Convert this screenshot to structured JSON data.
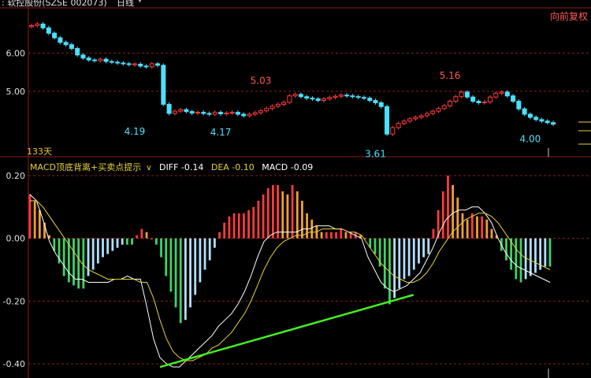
{
  "header": {
    "title": ": 软控股份(SZSE 002073)",
    "period": "日线",
    "adjust_button": "向前复权",
    "days_label": "133天"
  },
  "indicator_bar": {
    "name": "MACD顶底背离+买卖点提示",
    "diff": "DIFF -0.14",
    "dea": "DEA -0.10",
    "macd": "MACD -0.09"
  },
  "colors": {
    "background": "#000000",
    "up": "#ff3b3b",
    "up_light": "#f0a030",
    "down": "#4be0ff",
    "down_green": "#3fd36a",
    "down_light": "#b0e0ff",
    "diff_line": "#ffffff",
    "dea_line": "#e6d23a",
    "divergence_line": "#44ee22",
    "grid": "#8a1d1d",
    "axis_text": "#e0e0e0"
  },
  "chart_data": [
    {
      "type": "candlestick",
      "title": "",
      "y_ticks": [
        "6.00",
        "5.00"
      ],
      "ylim": [
        3.35,
        7.1
      ],
      "annotations": [
        {
          "label": "4.19",
          "index": 18,
          "value": 4.19,
          "kind": "low"
        },
        {
          "label": "4.17",
          "index": 33,
          "value": 4.17,
          "kind": "low"
        },
        {
          "label": "5.03",
          "index": 40,
          "value": 5.03,
          "kind": "high"
        },
        {
          "label": "3.61",
          "index": 60,
          "value": 3.61,
          "kind": "low"
        },
        {
          "label": "5.16",
          "index": 73,
          "value": 5.16,
          "kind": "high"
        },
        {
          "label": "4.00",
          "index": 87,
          "value": 4.0,
          "kind": "low"
        }
      ],
      "closes": [
        6.72,
        6.76,
        6.66,
        6.52,
        6.4,
        6.28,
        6.22,
        6.12,
        5.95,
        5.87,
        5.82,
        5.8,
        5.84,
        5.78,
        5.76,
        5.74,
        5.72,
        5.7,
        5.71,
        5.66,
        5.64,
        5.72,
        5.68,
        4.66,
        4.42,
        4.48,
        4.52,
        4.47,
        4.43,
        4.45,
        4.42,
        4.4,
        4.45,
        4.41,
        4.43,
        4.45,
        4.4,
        4.36,
        4.4,
        4.44,
        4.49,
        4.55,
        4.61,
        4.66,
        4.71,
        4.88,
        4.92,
        4.86,
        4.82,
        4.8,
        4.76,
        4.8,
        4.84,
        4.87,
        4.9,
        4.88,
        4.86,
        4.84,
        4.82,
        4.76,
        4.7,
        4.6,
        3.88,
        4.05,
        4.16,
        4.22,
        4.28,
        4.32,
        4.36,
        4.42,
        4.48,
        4.55,
        4.62,
        4.74,
        4.86,
        4.98,
        4.85,
        4.74,
        4.7,
        4.72,
        4.85,
        4.95,
        4.98,
        4.88,
        4.74,
        4.54,
        4.4,
        4.32,
        4.26,
        4.22,
        4.18,
        4.14
      ]
    },
    {
      "type": "bar+line",
      "title": "",
      "y_ticks": [
        "0.20",
        "0.00",
        "-0.20",
        "-0.40"
      ],
      "ylim": [
        -0.42,
        0.2
      ],
      "series": [
        {
          "name": "DIFF",
          "values": [
            0.14,
            0.12,
            0.06,
            -0.01,
            -0.05,
            -0.08,
            -0.11,
            -0.13,
            -0.13,
            -0.14,
            -0.14,
            -0.14,
            -0.14,
            -0.13,
            -0.13,
            -0.12,
            -0.13,
            -0.13,
            -0.22,
            -0.32,
            -0.38,
            -0.4,
            -0.41,
            -0.41,
            -0.39,
            -0.37,
            -0.35,
            -0.33,
            -0.31,
            -0.28,
            -0.26,
            -0.24,
            -0.21,
            -0.17,
            -0.12,
            -0.06,
            -0.01,
            0.01,
            0.02,
            0.02,
            0.02,
            0.02,
            0.03,
            0.03,
            0.04,
            0.04,
            0.04,
            0.03,
            0.03,
            0.02,
            0.01,
            0.0,
            -0.06,
            -0.1,
            -0.14,
            -0.16,
            -0.17,
            -0.16,
            -0.15,
            -0.13,
            -0.11,
            -0.07,
            -0.03,
            0.02,
            0.06,
            0.08,
            0.09,
            0.09,
            0.1,
            0.1,
            0.08,
            0.05,
            0.0,
            -0.04,
            -0.07,
            -0.09,
            -0.1,
            -0.11,
            -0.12,
            -0.13,
            -0.14
          ]
        },
        {
          "name": "DEA",
          "values": [
            0.12,
            0.12,
            0.1,
            0.07,
            0.04,
            0.01,
            -0.02,
            -0.05,
            -0.08,
            -0.1,
            -0.11,
            -0.12,
            -0.13,
            -0.13,
            -0.13,
            -0.13,
            -0.13,
            -0.14,
            -0.14,
            -0.19,
            -0.26,
            -0.32,
            -0.36,
            -0.38,
            -0.39,
            -0.39,
            -0.38,
            -0.37,
            -0.35,
            -0.34,
            -0.32,
            -0.3,
            -0.27,
            -0.24,
            -0.2,
            -0.15,
            -0.1,
            -0.06,
            -0.03,
            -0.01,
            0.0,
            0.01,
            0.01,
            0.02,
            0.02,
            0.03,
            0.03,
            0.03,
            0.03,
            0.02,
            0.02,
            0.01,
            -0.02,
            -0.05,
            -0.08,
            -0.1,
            -0.12,
            -0.13,
            -0.14,
            -0.14,
            -0.13,
            -0.11,
            -0.08,
            -0.04,
            -0.01,
            0.02,
            0.04,
            0.06,
            0.07,
            0.08,
            0.08,
            0.07,
            0.05,
            0.02,
            -0.01,
            -0.04,
            -0.06,
            -0.07,
            -0.08,
            -0.09,
            -0.1
          ]
        },
        {
          "name": "MACD",
          "values": [
            0.14,
            0.12,
            0.09,
            0.05,
            0.01,
            -0.04,
            -0.08,
            -0.12,
            -0.14,
            -0.15,
            -0.16,
            -0.16,
            -0.12,
            -0.1,
            -0.08,
            -0.06,
            -0.05,
            -0.04,
            -0.03,
            -0.02,
            -0.02,
            -0.02,
            0.01,
            0.03,
            0.02,
            0.0,
            -0.02,
            -0.06,
            -0.12,
            -0.17,
            -0.22,
            -0.27,
            -0.26,
            -0.22,
            -0.18,
            -0.14,
            -0.1,
            -0.07,
            -0.03,
            0.02,
            0.05,
            0.07,
            0.08,
            0.08,
            0.08,
            0.09,
            0.1,
            0.12,
            0.14,
            0.16,
            0.17,
            0.17,
            0.15,
            0.14,
            0.17,
            0.15,
            0.12,
            0.08,
            0.06,
            0.04,
            0.02,
            0.02,
            0.02,
            0.02,
            0.03,
            0.02,
            0.02,
            0.02,
            0.01,
            0.0,
            -0.03,
            -0.05,
            -0.09,
            -0.16,
            -0.21,
            -0.19,
            -0.16,
            -0.13,
            -0.12,
            -0.1,
            -0.08,
            -0.06,
            -0.05,
            0.03,
            0.09,
            0.15,
            0.2,
            0.17,
            0.13,
            0.08,
            0.06,
            0.08,
            0.07,
            0.07,
            0.06,
            0.03,
            0.01,
            -0.04,
            -0.07,
            -0.1,
            -0.13,
            -0.14,
            -0.13,
            -0.12,
            -0.11,
            -0.1,
            -0.09,
            -0.09
          ]
        }
      ],
      "divergence_line": {
        "from": {
          "index": 20,
          "value": -0.41
        },
        "to": {
          "index": 59,
          "value": -0.18
        }
      }
    }
  ]
}
